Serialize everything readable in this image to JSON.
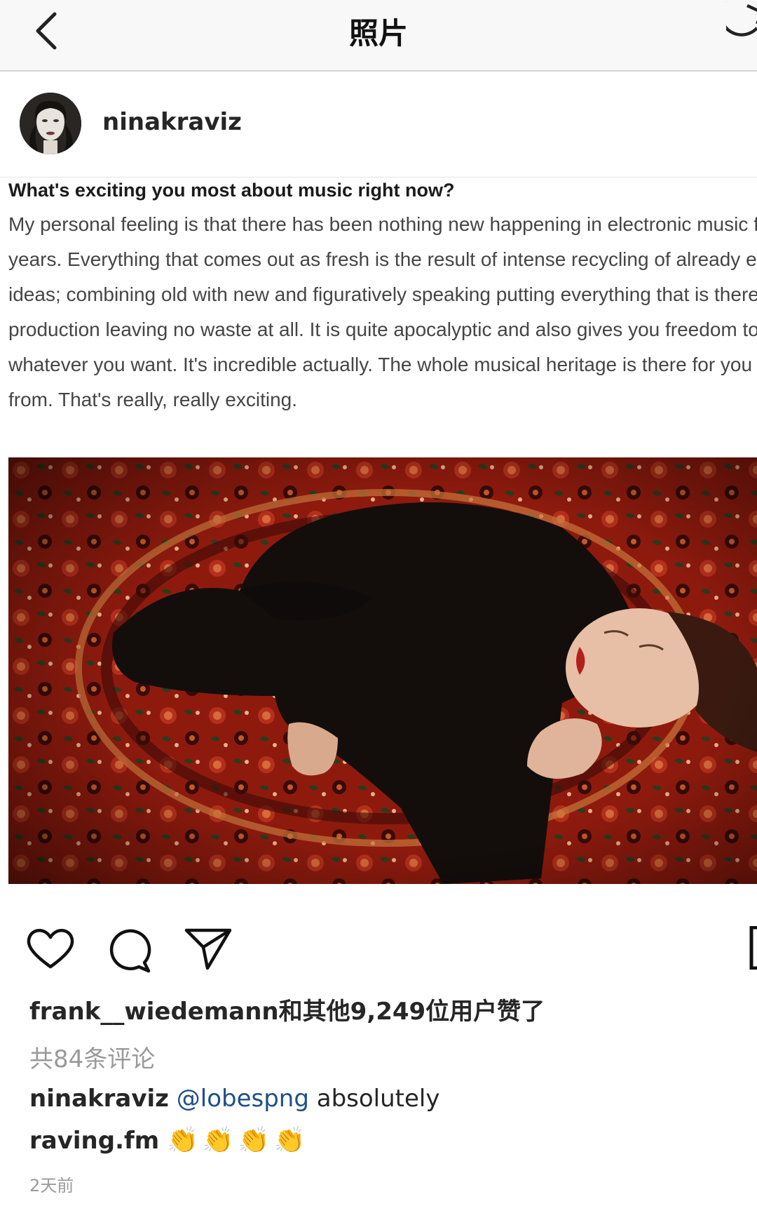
{
  "header": {
    "title": "照片",
    "back_icon": "chevron-left-icon",
    "refresh_icon": "refresh-icon"
  },
  "post": {
    "username": "ninakraviz",
    "article": {
      "question": "What's exciting you most about music right now?",
      "lines": [
        "My personal feeling is that there has been nothing new happening in electronic music for",
        "years. Everything that comes out as fresh is the result of intense recycling of already existin",
        "ideas; combining old with new and figuratively speaking putting everything that is there int",
        "production leaving no waste at all. It is quite apocalyptic and also gives you freedom to c",
        "whatever you want. It's incredible actually. The whole musical heritage is there for you to",
        "from. That's really, really exciting."
      ]
    },
    "likes_text": "frank__wiedemann和其他9,249位用户赞了",
    "view_comments": "共84条评论",
    "comments": [
      {
        "user": "ninakraviz",
        "mention": "@lobespng",
        "text": " absolutely"
      },
      {
        "user": "raving.fm",
        "text": "👏👏👏👏"
      }
    ],
    "timestamp": "2天前"
  },
  "icons": {
    "like": "heart-icon",
    "comment": "comment-icon",
    "share": "paper-plane-icon",
    "save": "bookmark-icon"
  },
  "colors": {
    "mention": "#1f4f86",
    "muted": "#9a9a9a",
    "carpet_red": "#8e1a0e"
  }
}
